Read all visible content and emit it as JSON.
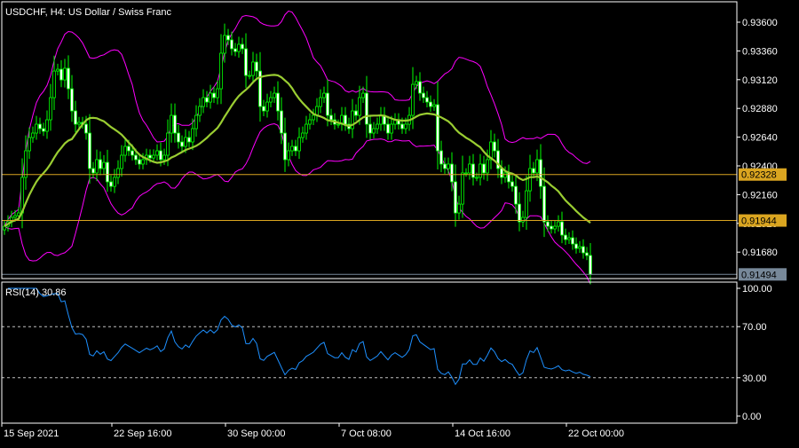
{
  "title": "USDCHF, H4:  US Dollar / Swiss Franc",
  "colors": {
    "background": "#000000",
    "frame": "#ffffff",
    "candle_outline": "#00ff00",
    "bull_body": "#000000",
    "bear_body": "#ffffff",
    "bollinger": "#ff00ff",
    "moving_average": "#9acd32",
    "level_line": "#daa520",
    "bid_line": "#778899",
    "rsi_line": "#1e90ff",
    "rsi_levels": "#c0c0c0"
  },
  "chart_data": [
    {
      "type": "candlestick",
      "symbol": "USDCHF",
      "timeframe": "H4",
      "title": "USDCHF, H4:  US Dollar / Swiss Franc",
      "indicators": [
        "Bollinger Bands",
        "Moving Average"
      ],
      "ylim": [
        0.9142,
        0.938
      ],
      "y_ticks": [
        "0.93600",
        "0.93360",
        "0.93120",
        "0.92880",
        "0.92640",
        "0.92400",
        "0.92160",
        "0.91920",
        "0.91680"
      ],
      "closes": [
        0.91896,
        0.91933,
        0.9197,
        0.91985,
        0.92007,
        0.92304,
        0.92526,
        0.92637,
        0.92674,
        0.92748,
        0.92711,
        0.92689,
        0.92785,
        0.9297,
        0.93192,
        0.93207,
        0.93118,
        0.93215,
        0.93044,
        0.92859,
        0.92748,
        0.92763,
        0.92748,
        0.92674,
        0.92378,
        0.92341,
        0.92452,
        0.92378,
        0.92429,
        0.92267,
        0.92229,
        0.92304,
        0.92378,
        0.92489,
        0.92563,
        0.92526,
        0.92489,
        0.92452,
        0.92415,
        0.92452,
        0.92489,
        0.92466,
        0.92489,
        0.92526,
        0.92452,
        0.92489,
        0.92674,
        0.92822,
        0.92674,
        0.926,
        0.92563,
        0.92637,
        0.926,
        0.92711,
        0.92822,
        0.92896,
        0.9297,
        0.92933,
        0.93007,
        0.9297,
        0.93044,
        0.93341,
        0.93489,
        0.93452,
        0.93378,
        0.93355,
        0.93415,
        0.93378,
        0.93155,
        0.93155,
        0.93267,
        0.93192,
        0.92896,
        0.92859,
        0.92933,
        0.9297,
        0.93007,
        0.92859,
        0.92674,
        0.92452,
        0.92526,
        0.92563,
        0.92526,
        0.92637,
        0.92674,
        0.92748,
        0.92785,
        0.92822,
        0.92896,
        0.9297,
        0.93007,
        0.92822,
        0.92785,
        0.92748,
        0.92748,
        0.92822,
        0.92748,
        0.92711,
        0.92859,
        0.92822,
        0.9297,
        0.93007,
        0.92748,
        0.92674,
        0.92711,
        0.92748,
        0.92822,
        0.92748,
        0.92674,
        0.92748,
        0.92785,
        0.92748,
        0.92711,
        0.92748,
        0.92822,
        0.93081,
        0.93104,
        0.93007,
        0.9297,
        0.92933,
        0.92896,
        0.92911,
        0.92526,
        0.92415,
        0.92378,
        0.92415,
        0.92267,
        0.92007,
        0.92081,
        0.92341,
        0.92341,
        0.92415,
        0.92304,
        0.92304,
        0.92415,
        0.92341,
        0.92452,
        0.926,
        0.92526,
        0.92378,
        0.92304,
        0.92341,
        0.92267,
        0.92229,
        0.92081,
        0.91933,
        0.9197,
        0.92192,
        0.92378,
        0.92341,
        0.92452,
        0.92229,
        0.91933,
        0.91896,
        0.91874,
        0.91896,
        0.91933,
        0.91822,
        0.91785,
        0.918,
        0.91748,
        0.91711,
        0.91726,
        0.91674,
        0.91652,
        0.91494
      ],
      "horizontal_levels": [
        {
          "value": 0.92328,
          "label": "0.92328"
        },
        {
          "value": 0.91944,
          "label": "0.91944"
        }
      ],
      "bid": {
        "value": 0.91494,
        "label": "0.91494"
      },
      "x_labels": [
        {
          "text": "15 Sep 2021",
          "bar": 0
        },
        {
          "text": "22 Sep 16:00",
          "bar": 31
        },
        {
          "text": "30 Sep 00:00",
          "bar": 63
        },
        {
          "text": "7 Oct 08:00",
          "bar": 95
        },
        {
          "text": "14 Oct 16:00",
          "bar": 127
        },
        {
          "text": "22 Oct 00:00",
          "bar": 159
        }
      ]
    },
    {
      "type": "line",
      "title": "RSI(14) 30.86",
      "period": 14,
      "last_value": 30.86,
      "ylim": [
        0,
        100
      ],
      "y_ticks": [
        "100.00",
        "70.00",
        "30.00",
        "0.00"
      ],
      "levels": [
        70,
        30
      ]
    }
  ]
}
